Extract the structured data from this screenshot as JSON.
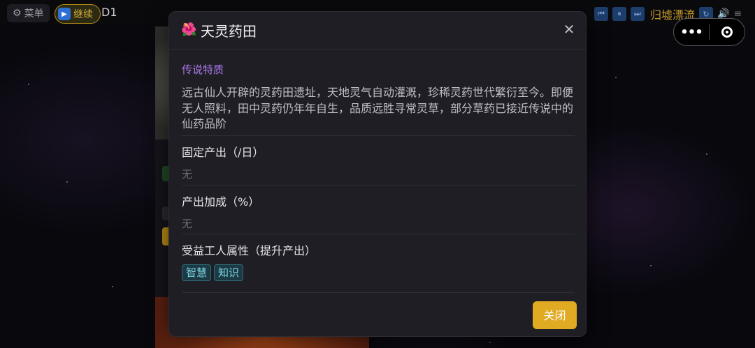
{
  "top_bar": {
    "menu_label": "菜单",
    "continue_label": "继续",
    "day": "D1",
    "zone_name": "归墟漂流"
  },
  "capsule": {
    "more_icon": "more-dots-icon",
    "close_icon": "target-circle-icon"
  },
  "modal": {
    "icon": "hibiscus-flower-icon",
    "icon_glyph": "🌺",
    "title": "天灵药田",
    "close_glyph": "✕",
    "legend": {
      "heading": "传说特质",
      "description": "远古仙人开辟的灵药田遗址，天地灵气自动灌溉，珍稀灵药世代繁衍至今。即便无人照料，田中灵药仍年年自生，品质远胜寻常灵草，部分草药已接近传说中的仙药品阶"
    },
    "fixed_output": {
      "heading": "固定产出（/日）",
      "value": "无"
    },
    "output_bonus": {
      "heading": "产出加成（%）",
      "value": "无"
    },
    "benefit_attrs": {
      "heading": "受益工人属性（提升产出）",
      "tags": [
        "智慧",
        "知识"
      ]
    },
    "close_button_label": "关闭"
  },
  "colors": {
    "accent_gold": "#e0aa22",
    "legend_purple": "#b07cf0",
    "tag_cyan": "#7fd6e4"
  }
}
